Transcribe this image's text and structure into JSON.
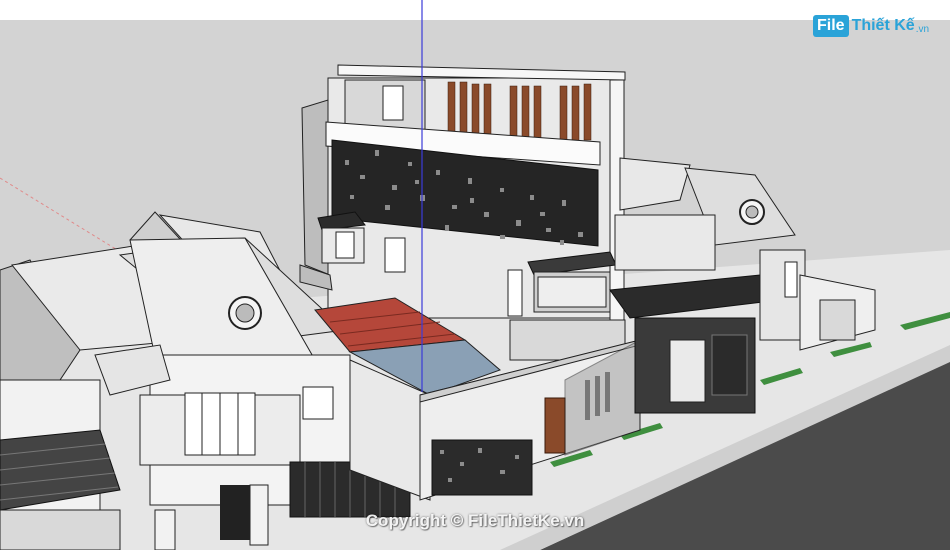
{
  "watermark": {
    "logo_file": "File",
    "logo_rest": "Thiết Kế",
    "logo_tld": ".vn",
    "copyright": "Copyright © FileThietKe.vn"
  },
  "colors": {
    "sky": "#d3d3d3",
    "ground": "#e6e6e6",
    "road": "#4b4b4b",
    "wall": "#f2f2f2",
    "wall_shade": "#bdbdbd",
    "dark_screen": "#2a2a2a",
    "wood": "#8a4a2a",
    "red_roof": "#b5473a",
    "grass": "#3f8f3f",
    "axis_blue": "#3b3bd9"
  },
  "icons": [
    "model-axis-blue",
    "house-3d-model"
  ]
}
